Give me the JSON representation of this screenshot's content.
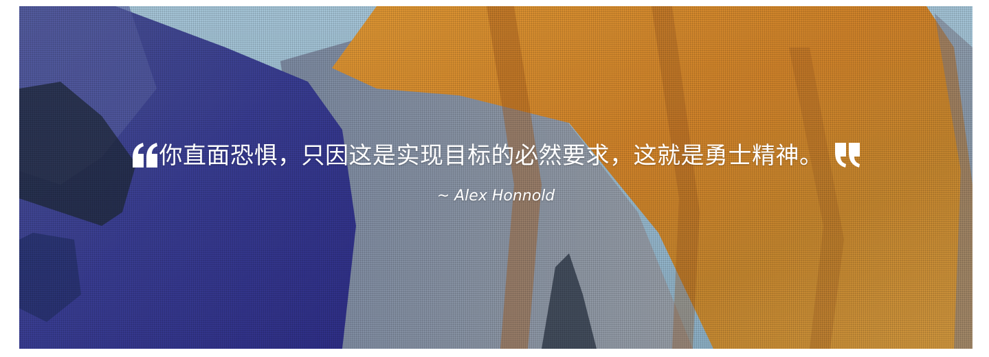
{
  "hero": {
    "background_description_icon": "mountain-photo",
    "quote": {
      "open_mark_icon": "open-quote-icon",
      "text": "你直面恐惧，只因这是实现目标的必然要求，这就是勇士精神。",
      "close_mark_icon": "close-quote-icon",
      "author": "~ Alex Honnold"
    },
    "colors": {
      "text": "#ffffff",
      "rock_orange": "#d98a2b",
      "rock_shadow_blue": "#3d3f9a",
      "sky": "#9fc3d8"
    }
  }
}
